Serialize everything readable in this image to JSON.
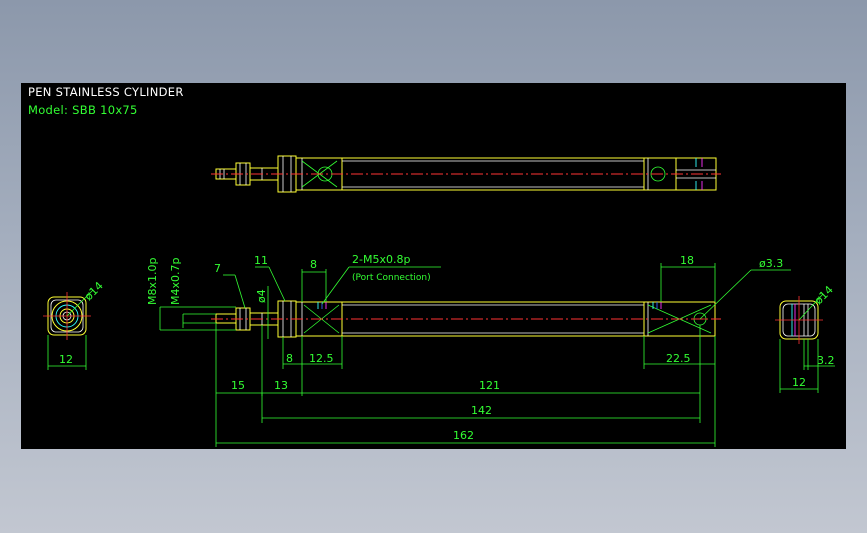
{
  "header": {
    "title": "PEN STAINLESS CYLINDER",
    "model": "Model: SBB 10x75"
  },
  "front_view": {
    "dia_left": "ø14",
    "width_left": "12"
  },
  "side_view": {
    "thread_rod": "M8x1.0p",
    "thread_tip": "M4x0.7p",
    "nut_width": "7",
    "hex_width": "11",
    "rod_dia": "ø4",
    "port_len": "8",
    "port_thread": "2-M5x0.8p",
    "port_note": "(Port Connection)",
    "rear_len": "18",
    "pin_dia": "ø3.3",
    "cap_len": "8",
    "port_pos": "12.5",
    "rear_pos": "22.5",
    "rod_len": "15",
    "nut_len": "13",
    "body_len": "121",
    "len_142": "142",
    "len_162": "162"
  },
  "rear_view": {
    "dia": "ø14",
    "slot": "3.2",
    "width": "12"
  },
  "colors": {
    "background": "#000000",
    "dimension": "#33ff33",
    "outline": "#ffff33",
    "centerline": "#ff3333",
    "title": "#ffffff"
  }
}
